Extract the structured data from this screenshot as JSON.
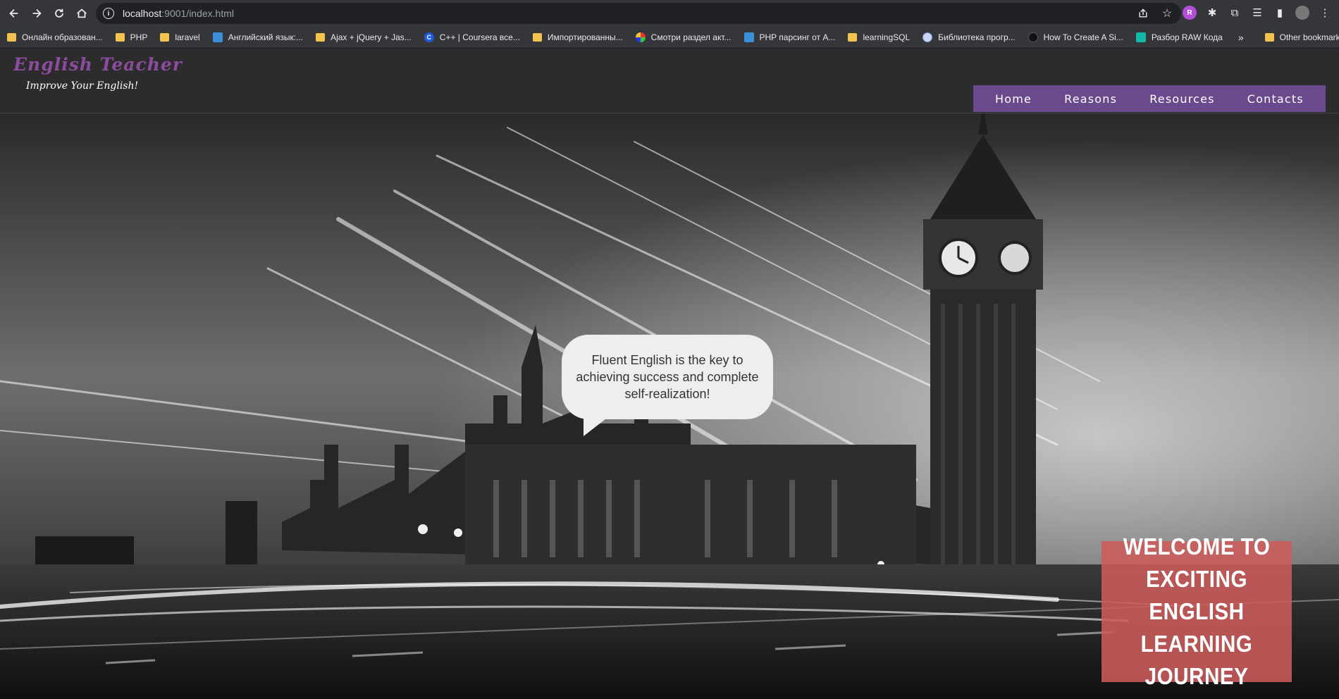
{
  "browser": {
    "url_host": "localhost",
    "url_rest": ":9001/index.html",
    "bookmarks": [
      {
        "label": "Онлайн образован...",
        "icon": "folder-icon"
      },
      {
        "label": "PHP",
        "icon": "folder-icon"
      },
      {
        "label": "laravel",
        "icon": "folder-icon"
      },
      {
        "label": "Английский язык:...",
        "icon": "bookmark-site-icon"
      },
      {
        "label": "Ajax + jQuery + Jas...",
        "icon": "folder-icon"
      },
      {
        "label": "C++ | Coursera все...",
        "icon": "coursera-icon"
      },
      {
        "label": "Импортированны...",
        "icon": "folder-icon"
      },
      {
        "label": "Смотри раздел акт...",
        "icon": "colorful-site-icon"
      },
      {
        "label": "PHP парсинг от А...",
        "icon": "bookmark-site-icon"
      },
      {
        "label": "learningSQL",
        "icon": "folder-icon"
      },
      {
        "label": "Библиотека прогр...",
        "icon": "wiki-icon"
      },
      {
        "label": "How To Create A Si...",
        "icon": "dark-site-icon"
      },
      {
        "label": "Разбор RAW Кода",
        "icon": "teal-site-icon"
      }
    ],
    "bookmarks_more": "»",
    "other_bookmarks": "Other bookmarks"
  },
  "site": {
    "logo_title": "English Teacher",
    "logo_subtitle": "Improve Your English!",
    "nav": [
      "Home",
      "Reasons",
      "Resources",
      "Contacts"
    ],
    "bubble_text": "Fluent English is the key to achieving success and complete self-realization!",
    "welcome_text": "WELCOME TO EXCITING ENGLISH LEARNING JOURNEY"
  },
  "colors": {
    "brand_purple": "#8c4c9e",
    "nav_bg": "#6a4a8c",
    "welcome_bg": "#cc5c5c"
  }
}
